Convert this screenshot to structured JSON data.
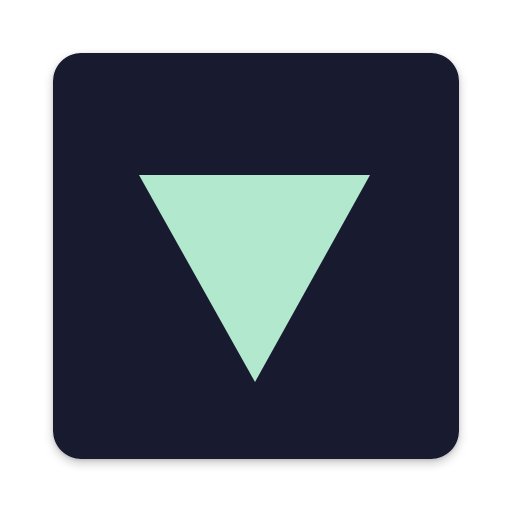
{
  "app_icon": {
    "icon_name": "triangle-down-icon",
    "background_color": "#181a2f",
    "glyph_color": "#b2e8cd"
  }
}
